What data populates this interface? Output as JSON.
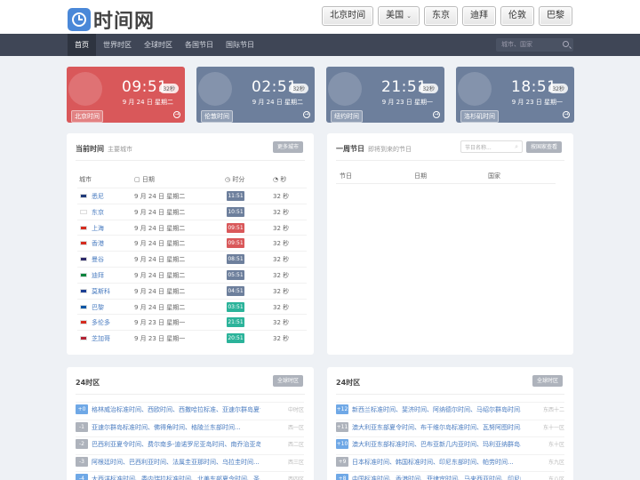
{
  "logo": {
    "text": "时间网"
  },
  "topnav": [
    "北京时间",
    "美国",
    "东京",
    "迪拜",
    "伦敦",
    "巴黎"
  ],
  "mainnav": [
    "首页",
    "世界时区",
    "全球时区",
    "各国节日",
    "国际节日"
  ],
  "search": {
    "placeholder": "城市、国家"
  },
  "clocks": [
    {
      "time": "09:51",
      "sec": "32秒",
      "date": "9 月 24 日 星期二",
      "label": "北京时间",
      "color": "#d9585a"
    },
    {
      "time": "02:51",
      "sec": "32秒",
      "date": "9 月 24 日 星期二",
      "label": "伦敦时间",
      "color": "#6d7f9c"
    },
    {
      "time": "21:51",
      "sec": "32秒",
      "date": "9 月 23 日 星期一",
      "label": "纽约时间",
      "color": "#6d7f9c"
    },
    {
      "time": "18:51",
      "sec": "32秒",
      "date": "9 月 23 日 星期一",
      "label": "洛杉矶时间",
      "color": "#6d7f9c"
    }
  ],
  "current": {
    "title": "当前时间",
    "subtitle": "主要城市",
    "button": "更多城市",
    "headers": [
      "城市",
      "日期",
      "时分",
      "秒"
    ],
    "rows": [
      {
        "city": "悉尼",
        "date": "9 月 24 日 星期二",
        "time": "11:51",
        "sec": "32 秒",
        "color": "#6d7f9c",
        "flag": "#1f3a7a"
      },
      {
        "city": "东京",
        "date": "9 月 24 日 星期二",
        "time": "10:51",
        "sec": "32 秒",
        "color": "#6d7f9c",
        "flag": "#ffffff"
      },
      {
        "city": "上海",
        "date": "9 月 24 日 星期二",
        "time": "09:51",
        "sec": "32 秒",
        "color": "#d9585a",
        "flag": "#d52b1e"
      },
      {
        "city": "香港",
        "date": "9 月 24 日 星期二",
        "time": "09:51",
        "sec": "32 秒",
        "color": "#d9585a",
        "flag": "#d52b1e"
      },
      {
        "city": "曼谷",
        "date": "9 月 24 日 星期二",
        "time": "08:51",
        "sec": "32 秒",
        "color": "#6d7f9c",
        "flag": "#2d2a6a"
      },
      {
        "city": "迪拜",
        "date": "9 月 24 日 星期二",
        "time": "05:51",
        "sec": "32 秒",
        "color": "#6d7f9c",
        "flag": "#00843d"
      },
      {
        "city": "莫斯科",
        "date": "9 月 24 日 星期二",
        "time": "04:51",
        "sec": "32 秒",
        "color": "#6d7f9c",
        "flag": "#1c3f94"
      },
      {
        "city": "巴黎",
        "date": "9 月 24 日 星期二",
        "time": "03:51",
        "sec": "32 秒",
        "color": "#2bb39a",
        "flag": "#0055a4"
      },
      {
        "city": "多伦多",
        "date": "9 月 23 日 星期一",
        "time": "21:51",
        "sec": "32 秒",
        "color": "#2bb39a",
        "flag": "#d52b1e"
      },
      {
        "city": "芝加哥",
        "date": "9 月 23 日 星期一",
        "time": "20:51",
        "sec": "32 秒",
        "color": "#2bb39a",
        "flag": "#b22234"
      }
    ]
  },
  "holidays": {
    "title": "一周节日",
    "subtitle": "即将到来的节日",
    "placeholder": "节日名称...",
    "button": "按国家查看",
    "headers": [
      "节日",
      "日期",
      "国家"
    ]
  },
  "tz_left": {
    "title": "24时区",
    "button": "全球时区",
    "rows": [
      {
        "badge": "+0",
        "name": "格林威治标准时间、西欧时间、西撒哈拉标准、亚速尔群岛夏令...",
        "region": "中时区",
        "color": "#6fa8e6"
      },
      {
        "badge": "-1",
        "name": "亚速尔群岛标准时间、佛得角时间、格陵兰东部时间...",
        "region": "西一区",
        "color": "#aeb3bc"
      },
      {
        "badge": "-2",
        "name": "巴西利亚夏令时间、费尔南多-迪诺罗尼亚岛时间、南乔治亚岛时间...",
        "region": "西二区",
        "color": "#aeb3bc"
      },
      {
        "badge": "-3",
        "name": "阿根廷时间、巴西利亚时间、法属圭亚那时间、乌拉圭时间...",
        "region": "西三区",
        "color": "#aeb3bc"
      },
      {
        "badge": "-4",
        "name": "大西洋标准时间、委内瑞拉标准时间、北美东部夏令时间、圣皮...",
        "region": "西四区",
        "color": "#6fa8e6"
      }
    ]
  },
  "tz_right": {
    "title": "24时区",
    "button": "全球时区",
    "rows": [
      {
        "badge": "+12",
        "name": "新西兰标准时间、斐济时间、阿纳德尔时间、马绍尔群岛时间...",
        "region": "东西十二",
        "color": "#6fa8e6"
      },
      {
        "badge": "+11",
        "name": "澳大利亚东部夏令时间、布干维尔岛标准时间、瓦努阿图时间...",
        "region": "东十一区",
        "color": "#aeb3bc"
      },
      {
        "badge": "+10",
        "name": "澳大利亚东部标准时间、巴布亚新几内亚时间、玛利亚纳群岛...",
        "region": "东十区",
        "color": "#6fa8e6"
      },
      {
        "badge": "+9",
        "name": "日本标准时间、韩国标准时间、印尼东部时间、帕劳时间...",
        "region": "东九区",
        "color": "#aeb3bc"
      },
      {
        "badge": "+8",
        "name": "中国标准时间、香港时间、菲律宾时间、马来西亚时间、印尼中...",
        "region": "东八区",
        "color": "#6fa8e6"
      }
    ]
  }
}
